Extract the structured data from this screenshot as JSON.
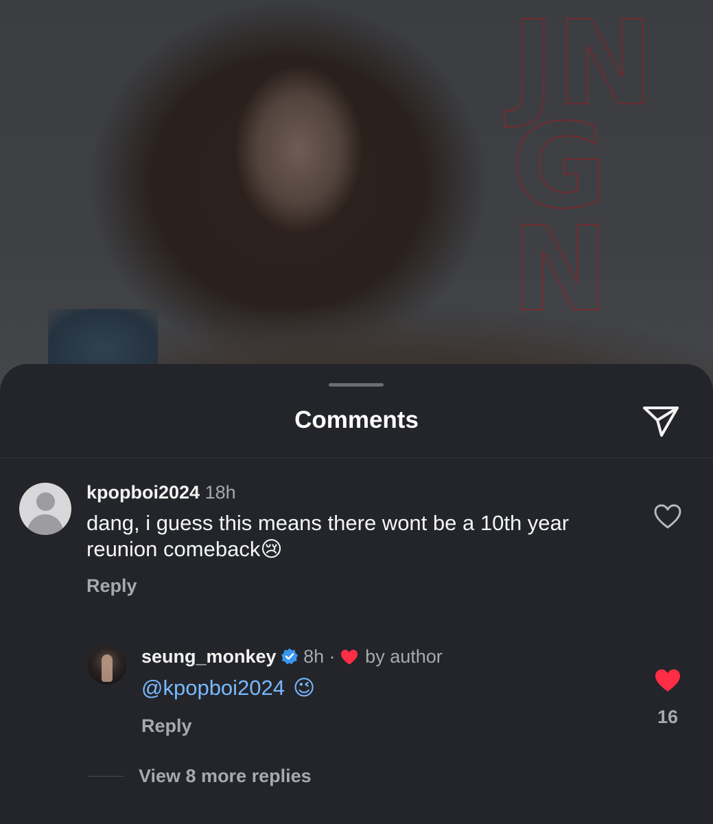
{
  "post": {
    "outline_text": [
      "JN",
      "G",
      "N"
    ]
  },
  "sheet": {
    "title": "Comments"
  },
  "comments": [
    {
      "username": "kpopboi2024",
      "time": "18h",
      "text": "dang, i guess this means there wont be a 10th year reunion comeback",
      "emoji": "😢",
      "reply_label": "Reply",
      "liked": false
    }
  ],
  "replies": [
    {
      "username": "seung_monkey",
      "verified": true,
      "time": "8h",
      "separator": "·",
      "author_like_label": "by author",
      "mention": "@kpopboi2024",
      "emoji": "😉",
      "reply_label": "Reply",
      "liked": true,
      "like_count": "16"
    }
  ],
  "view_more_label": "View 8 more replies",
  "colors": {
    "background": "#23252a",
    "mention": "#79b9ff",
    "like_red": "#ff2d45",
    "verified_blue": "#3897f0",
    "muted_text": "#a8a9ad"
  }
}
